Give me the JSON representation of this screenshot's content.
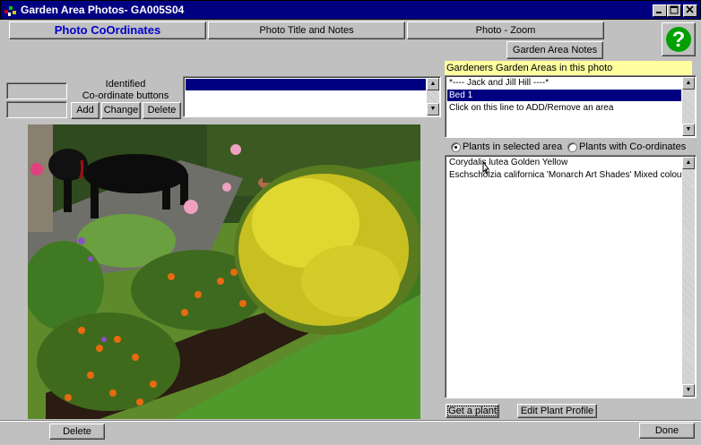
{
  "window": {
    "title": "Garden Area Photos- GA005S04"
  },
  "tabs": [
    {
      "label": "Photo CoOrdinates"
    },
    {
      "label": "Photo Title and Notes"
    },
    {
      "label": "Photo - Zoom"
    }
  ],
  "garden_area_notes_label": "Garden Area Notes",
  "help_icon_glyph": "?",
  "identified": {
    "line1": "Identified",
    "line2": "Co-ordinate buttons",
    "add_label": "Add",
    "change_label": "Change",
    "delete_label": "Delete"
  },
  "areas": {
    "header": "Gardeners Garden Areas in this photo",
    "items": [
      {
        "text": "*---- Jack and Jill Hill ----*"
      },
      {
        "text": "Bed 1"
      },
      {
        "text": "Click on this line to ADD/Remove an area"
      }
    ]
  },
  "plants": {
    "radio_selected_label": "Plants in selected area",
    "radio_coords_label": "Plants with Co-ordinates",
    "items": [
      {
        "text": "Corydalis lutea   Golden  Yellow"
      },
      {
        "text": "Eschscholzia californica  'Monarch Art Shades' Mixed colours"
      }
    ],
    "get_plant_label": "Get a plant",
    "edit_profile_label": "Edit Plant Profile"
  },
  "footer": {
    "delete_label": "Delete",
    "done_label": "Done"
  },
  "colors": {
    "titlebar": "#000080",
    "active_tab_text": "#0000cc",
    "selection": "#000080",
    "header_yellow": "#ffffa0",
    "help_green": "#00a000"
  }
}
